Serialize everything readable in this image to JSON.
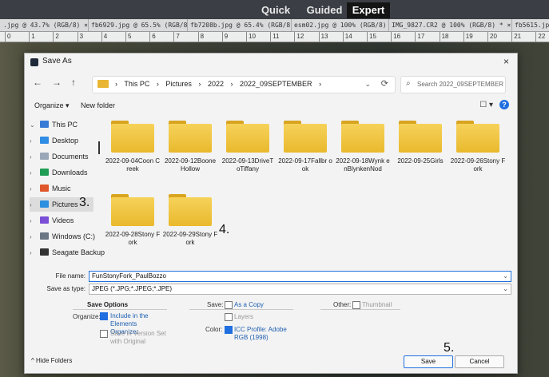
{
  "app": {
    "modes": [
      "Quick",
      "Guided",
      "Expert"
    ],
    "active_mode": "Expert",
    "doc_tabs": [
      ".jpg @ 43.7% (RGB/8) ×",
      "fb6929.jpg @ 65.5% (RGB/8) ×",
      "fb7208b.jpg @ 65.4% (RGB/8) ×",
      "esm02.jpg @ 100% (RGB/8) ×",
      "IMG_9827.CR2 @ 100% (RGB/8) * ×",
      "fb5615.jpg @"
    ],
    "ruler_ticks": [
      "0",
      "1",
      "2",
      "3",
      "4",
      "5",
      "6",
      "7",
      "8",
      "9",
      "10",
      "11",
      "12",
      "13",
      "14",
      "15",
      "16",
      "17",
      "18",
      "19",
      "20",
      "21",
      "22"
    ]
  },
  "dialog": {
    "title": "Save As",
    "close": "×",
    "nav": {
      "back": "←",
      "forward": "→",
      "up": "↑"
    },
    "breadcrumbs": [
      "›",
      "This PC",
      "›",
      "Pictures",
      "›",
      "2022",
      "›",
      "2022_09SEPTEMBER",
      "›"
    ],
    "address_dropdown": "⌄",
    "refresh": "⟳",
    "search_placeholder": "Search 2022_09SEPTEMBER",
    "search_icon": "⌕",
    "toolbar": {
      "organize": "Organize ▾",
      "new_folder": "New folder",
      "view": "☐ ▾",
      "help": "?"
    },
    "nav_pane": [
      {
        "label": "This PC",
        "chev": "⌄",
        "icon": "pc-icon",
        "color": "#3a7bd5"
      },
      {
        "label": "Desktop",
        "chev": "›",
        "icon": "desktop-icon",
        "color": "#2f8de4"
      },
      {
        "label": "Documents",
        "chev": "›",
        "icon": "documents-icon",
        "color": "#9aa7b8"
      },
      {
        "label": "Downloads",
        "chev": "›",
        "icon": "downloads-icon",
        "color": "#1f9d55"
      },
      {
        "label": "Music",
        "chev": "›",
        "icon": "music-icon",
        "color": "#e0572c"
      },
      {
        "label": "Pictures",
        "chev": "›",
        "icon": "pictures-icon",
        "color": "#2d8fe0"
      },
      {
        "label": "Videos",
        "chev": "›",
        "icon": "videos-icon",
        "color": "#7b4fd6"
      },
      {
        "label": "Windows (C:)",
        "chev": "›",
        "icon": "drive-icon",
        "color": "#6b7785"
      },
      {
        "label": "Seagate Backup",
        "chev": "›",
        "icon": "external-drive-icon",
        "color": "#333333"
      }
    ],
    "folders": [
      "2022-09-04CoonCreek",
      "2022-09-12BooneHollow",
      "2022-09-13DriveToTiffany",
      "2022-09-17Fallbrook",
      "2022-09-18WynkenBlynkenNod",
      "2022-09-25Girls",
      "2022-09-26StonyFork",
      "2022-09-28StonyFork",
      "2022-09-29StonyFork"
    ],
    "folder_display_names": [
      "2022-09-04Coon Creek",
      "2022-09-12Boone Hollow",
      "2022-09-13DriveT oTiffany",
      "2022-09-17Fallbr ook",
      "2022-09-18Wynk enBlynkenNod",
      "2022-09-25Girls",
      "2022-09-26Stony Fork",
      "2022-09-28Stony Fork",
      "2022-09-29Stony Fork"
    ],
    "annotations": [
      "3.",
      "4.",
      "5."
    ],
    "file_name_label": "File name:",
    "file_name_value": "FunStonyFork_PaulBozzo",
    "save_as_type_label": "Save as type:",
    "save_as_type_value": "JPEG (*.JPG;*.JPEG;*.JPE)",
    "save_options": {
      "heading": "Save Options",
      "organize_label": "Organize:",
      "include_in_organizer": "Include in the Elements Organizer",
      "save_in_version_set": "Save in Version Set with Original",
      "save_label": "Save:",
      "as_a_copy": "As a Copy",
      "layers": "Layers",
      "color_label": "Color:",
      "icc_profile": "ICC Profile: Adobe RGB (1998)",
      "other_label": "Other:",
      "thumbnail": "Thumbnail"
    },
    "hide_folders": "^ Hide Folders",
    "save_button": "Save",
    "cancel_button": "Cancel",
    "accent_color": "#1f6fe0",
    "folder_color": "#e9b92d"
  }
}
